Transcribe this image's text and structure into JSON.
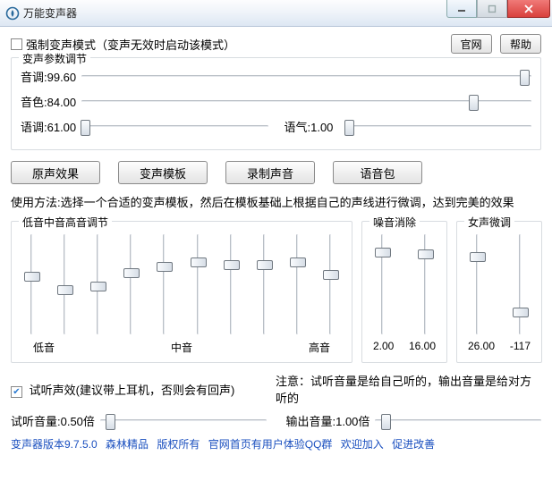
{
  "window": {
    "title": "万能变声器"
  },
  "top": {
    "force_mode_label": "强制变声模式（变声无效时启动该模式）",
    "force_mode_checked": false,
    "btn_official": "官网",
    "btn_help": "帮助"
  },
  "params": {
    "group_title": "变声参数调节",
    "pitch_label": "音调:99.60",
    "timbre_label": "音色:84.00",
    "intonation_label": "语调:61.00",
    "tone_label": "语气:1.00",
    "pitch_pos": 0.985,
    "timbre_pos": 0.87,
    "intonation_pos": 0.02,
    "tone_pos": 0.02
  },
  "actions": {
    "orig": "原声效果",
    "templates": "变声模板",
    "record": "录制声音",
    "pack": "语音包"
  },
  "usage_text": "使用方法:选择一个合适的变声模板，然后在模板基础上根据自己的声线进行微调，达到完美的效果",
  "eq": {
    "group_title": "低音中音高音调节",
    "label_low": "低音",
    "label_mid": "中音",
    "label_high": "高音",
    "positions": [
      0.42,
      0.55,
      0.52,
      0.38,
      0.32,
      0.28,
      0.3,
      0.3,
      0.28,
      0.4
    ]
  },
  "noise": {
    "group_title": "噪音消除",
    "positions": [
      0.18,
      0.2
    ],
    "val_a": "2.00",
    "val_b": "16.00"
  },
  "female": {
    "group_title": "女声微调",
    "positions": [
      0.22,
      0.78
    ],
    "val_a": "26.00",
    "val_b": "-117"
  },
  "listen": {
    "checkbox_label": "试听声效(建议带上耳机，否则会有回声)",
    "checked": true,
    "note": "注意：试听音量是给自己听的，输出音量是给对方听的",
    "test_vol_label": "试听音量:0.50倍",
    "out_vol_label": "输出音量:1.00倍",
    "test_pos": 0.06,
    "out_pos": 0.06
  },
  "footer": {
    "a": "变声器版本9.7.5.0",
    "b": "森林精品",
    "c": "版权所有",
    "d": "官网首页有用户体验QQ群",
    "e": "欢迎加入",
    "f": "促进改善"
  }
}
